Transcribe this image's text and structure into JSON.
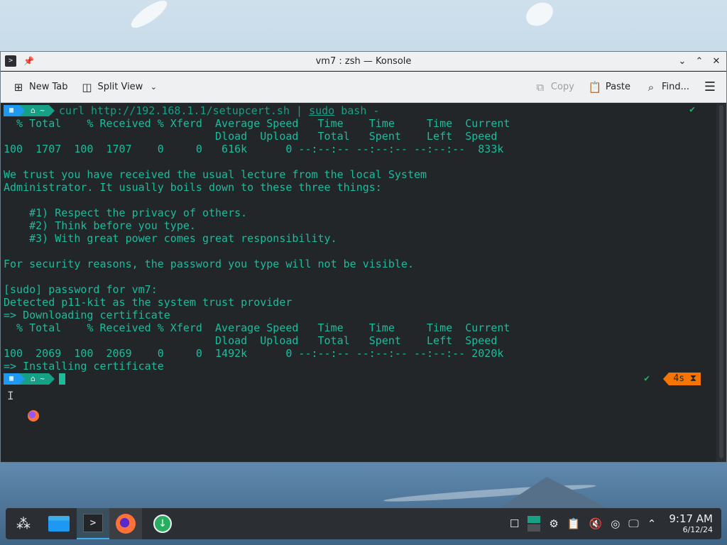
{
  "window": {
    "title": "vm7 : zsh — Konsole"
  },
  "toolbar": {
    "new_tab": "New Tab",
    "split_view": "Split View",
    "copy": "Copy",
    "paste": "Paste",
    "find": "Find..."
  },
  "terminal": {
    "prompt_dir": "~",
    "command_curl": "curl http://192.168.1.1/setupcert.sh | ",
    "command_sudo": "sudo",
    "command_rest": " bash -",
    "lines": [
      "  % Total    % Received % Xferd  Average Speed   Time    Time     Time  Current",
      "                                 Dload  Upload   Total   Spent    Left  Speed",
      "100  1707  100  1707    0     0   616k      0 --:--:-- --:--:-- --:--:--  833k",
      "",
      "We trust you have received the usual lecture from the local System",
      "Administrator. It usually boils down to these three things:",
      "",
      "    #1) Respect the privacy of others.",
      "    #2) Think before you type.",
      "    #3) With great power comes great responsibility.",
      "",
      "For security reasons, the password you type will not be visible.",
      "",
      "[sudo] password for vm7:",
      "Detected p11-kit as the system trust provider",
      "=> Downloading certificate",
      "  % Total    % Received % Xferd  Average Speed   Time    Time     Time  Current",
      "                                 Dload  Upload   Total   Spent    Left  Speed",
      "100  2069  100  2069    0     0  1492k      0 --:--:-- --:--:-- --:--:-- 2020k",
      "=> Installing certificate"
    ],
    "elapsed": "4s"
  },
  "taskbar": {
    "time": "9:17 AM",
    "date": "6/12/24"
  }
}
